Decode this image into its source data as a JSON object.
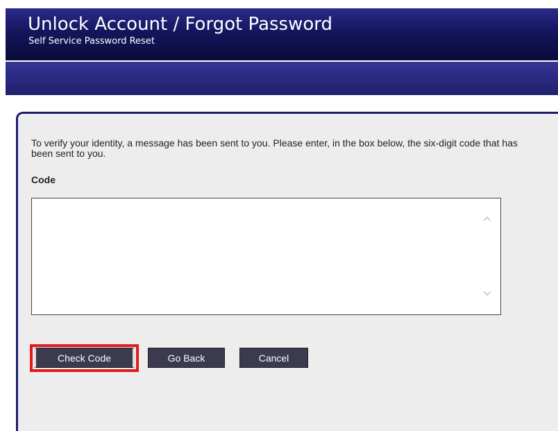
{
  "header": {
    "title": "Unlock Account / Forgot Password",
    "subtitle": "Self Service Password Reset"
  },
  "form": {
    "instructions": "To verify your identity, a message has been sent to you. Please enter, in the box below, the six-digit code that has been sent to you.",
    "code_label": "Code",
    "code_value": ""
  },
  "buttons": {
    "check_code": "Check Code",
    "go_back": "Go Back",
    "cancel": "Cancel"
  },
  "colors": {
    "header_dark": "#0a0a3a",
    "nav_band": "#2a2a82",
    "button_bg": "#3b3a4f",
    "highlight": "#e01b1b"
  }
}
